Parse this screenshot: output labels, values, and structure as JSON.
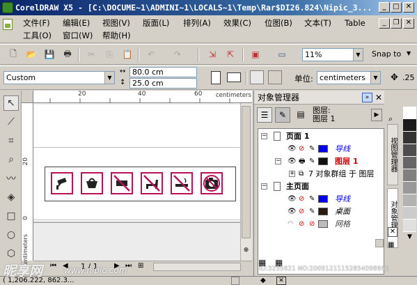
{
  "window": {
    "title": "CorelDRAW X5 - [C:\\DOCUME~1\\ADMINI~1\\LOCALS~1\\Temp\\Rar$DI26.824\\Nipic_3..."
  },
  "menu": [
    {
      "label": "文件(F)"
    },
    {
      "label": "编辑(E)"
    },
    {
      "label": "视图(V)"
    },
    {
      "label": "版面(L)"
    },
    {
      "label": "排列(A)"
    },
    {
      "label": "效果(C)"
    },
    {
      "label": "位图(B)"
    },
    {
      "label": "文本(T)"
    },
    {
      "label": "Table"
    },
    {
      "label": "工具(O)"
    },
    {
      "label": "窗口(W)"
    },
    {
      "label": "帮助(H)"
    }
  ],
  "standard_toolbar": {
    "zoom": "11%",
    "snap": "Snap to"
  },
  "property_bar": {
    "paper": "Custom",
    "width": "80.0 cm",
    "height": "25.0 cm",
    "units_label": "单位:",
    "units": "centimeters",
    "nudge": ".25"
  },
  "ruler": {
    "unit": "centimeters",
    "h_ticks": [
      "20",
      "40",
      "60"
    ],
    "v_ticks": [
      "20",
      "0"
    ],
    "v_unit": "centimeters"
  },
  "pager": {
    "page": "1 / 1"
  },
  "docker": {
    "title": "对象管理器",
    "layer_label": "图层:",
    "layer_value": "图层 1",
    "tree": {
      "page1": "页面 1",
      "guides": "导线",
      "layer1": "图层 1",
      "group": "7 对象群组 于 图层",
      "master": "主页面",
      "master_guides": "导线",
      "desktop": "桌面",
      "grid": "网格"
    }
  },
  "side_tabs": [
    "视图管理器",
    "对象管理器"
  ],
  "status": {
    "coords": "( 1,206.222, 862.3..."
  },
  "watermark": {
    "brand": "昵享网",
    "url": "www.nipic.com",
    "id": "ID:3255621 NO:20091211152854098962"
  },
  "colors": {
    "accent": "#0a246a",
    "sign_border": "#b8115a",
    "guide_blue": "#0000ee",
    "layer_red": "#cc0000"
  }
}
